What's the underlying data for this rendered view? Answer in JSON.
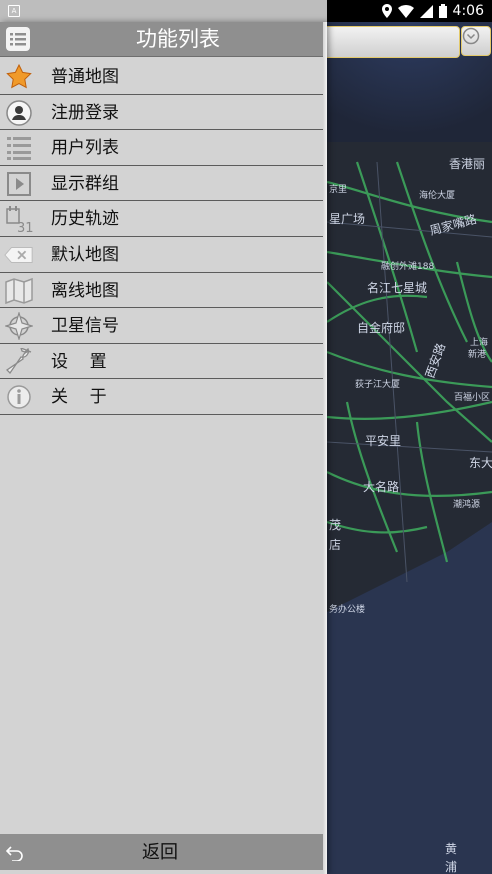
{
  "status_bar": {
    "time": "4:06",
    "icons": [
      "location-icon",
      "wifi-icon",
      "signal-icon",
      "battery-icon"
    ]
  },
  "drawer": {
    "title": "功能列表",
    "items": [
      {
        "label": "普通地图",
        "icon": "star-icon"
      },
      {
        "label": "注册登录",
        "icon": "user-icon"
      },
      {
        "label": "用户列表",
        "icon": "list-icon"
      },
      {
        "label": "显示群组",
        "icon": "play-icon"
      },
      {
        "label": "历史轨迹",
        "icon": "calendar-icon"
      },
      {
        "label": "默认地图",
        "icon": "clear-icon"
      },
      {
        "label": "离线地图",
        "icon": "map-icon"
      },
      {
        "label": "卫星信号",
        "icon": "compass-icon"
      },
      {
        "label": "设    置",
        "icon": "wrench-icon"
      },
      {
        "label": "关    于",
        "icon": "info-icon"
      }
    ],
    "back_label": "返回"
  },
  "map": {
    "labels": [
      "香港丽",
      "海伦大厦",
      "星广场",
      "周家嘴路",
      "融创外滩188",
      "名江七星城",
      "自金府邸",
      "西安路",
      "上海",
      "新港",
      "荻子江大厦",
      "百福小区",
      "平安里",
      "东大",
      "大名路",
      "潮鸿源",
      "茂",
      "店",
      "务办公楼",
      "黄",
      "浦",
      "京里"
    ]
  },
  "colors": {
    "drawer_bg": "#d3d3d3",
    "header_bg": "#8f8f8f",
    "map_bg": "#1f2638",
    "road": "#3fae5f"
  }
}
